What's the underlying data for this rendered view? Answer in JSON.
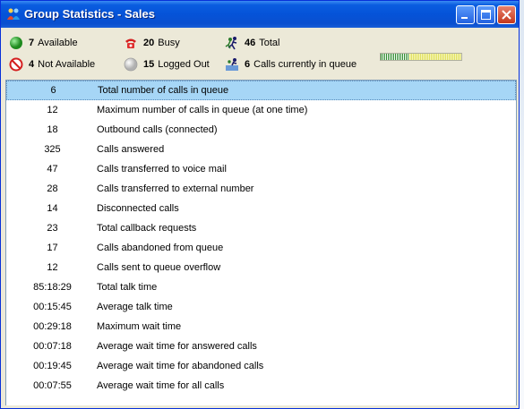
{
  "window": {
    "title": "Group Statistics - Sales"
  },
  "status": {
    "available": {
      "count": "7",
      "label": "Available"
    },
    "busy": {
      "count": "20",
      "label": "Busy"
    },
    "total": {
      "count": "46",
      "label": "Total"
    },
    "not_available": {
      "count": "4",
      "label": "Not Available"
    },
    "logged_out": {
      "count": "15",
      "label": "Logged Out"
    },
    "in_queue": {
      "count": "6",
      "label": "Calls currently in queue"
    },
    "queue_meter": {
      "level": 0.35
    }
  },
  "stats": [
    {
      "value": "6",
      "label": "Total number of calls in queue",
      "selected": true
    },
    {
      "value": "12",
      "label": "Maximum number of calls in queue (at one time)"
    },
    {
      "value": "18",
      "label": "Outbound calls (connected)"
    },
    {
      "value": "325",
      "label": "Calls answered"
    },
    {
      "value": "47",
      "label": "Calls transferred to voice mail"
    },
    {
      "value": "28",
      "label": "Calls transferred to external number"
    },
    {
      "value": "14",
      "label": "Disconnected calls"
    },
    {
      "value": "23",
      "label": "Total callback requests"
    },
    {
      "value": "17",
      "label": "Calls abandoned from queue"
    },
    {
      "value": "12",
      "label": "Calls sent to queue overflow"
    },
    {
      "value": "85:18:29",
      "label": "Total talk time"
    },
    {
      "value": "00:15:45",
      "label": "Average talk time"
    },
    {
      "value": "00:29:18",
      "label": "Maximum wait time"
    },
    {
      "value": "00:07:18",
      "label": "Average wait time for answered calls"
    },
    {
      "value": "00:19:45",
      "label": "Average wait time for abandoned calls"
    },
    {
      "value": "00:07:55",
      "label": "Average wait time for all calls"
    }
  ],
  "colors": {
    "titlebar": "#0553d8",
    "selection": "#a6d6f6",
    "available": "#2eaa2e",
    "busy": "#d42020"
  }
}
